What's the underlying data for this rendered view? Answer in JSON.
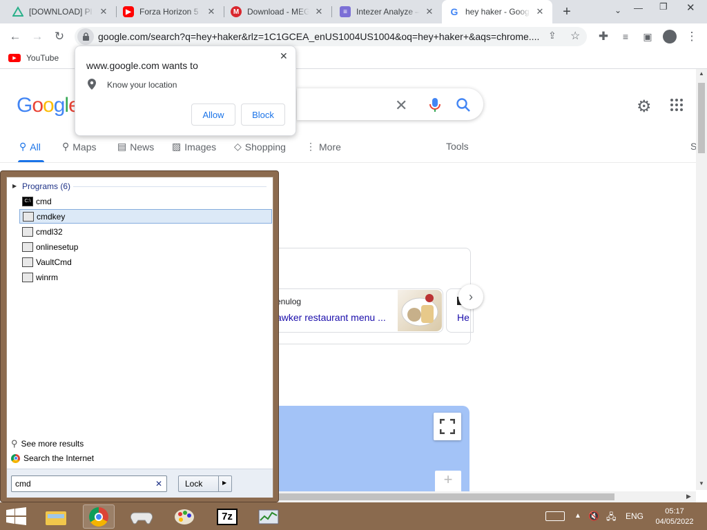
{
  "tabs": [
    {
      "title": "[DOWNLOAD] Pl",
      "icon": "triangle-icon",
      "close": "✕"
    },
    {
      "title": "Forza Horizon 5 (",
      "icon": "youtube-icon",
      "close": "✕"
    },
    {
      "title": "Download - MEG",
      "icon": "mega-icon",
      "close": "✕"
    },
    {
      "title": "Intezer Analyze –",
      "icon": "intezer-icon",
      "close": "✕"
    },
    {
      "title": "hey haker - Goog",
      "icon": "google-icon",
      "close": "✕"
    }
  ],
  "new_tab": "+",
  "url": "google.com/search?q=hey+haker&rlz=1C1GCEA_enUS1004US1004&oq=hey+haker+&aqs=chrome....",
  "bookmarks": [
    {
      "label": "YouTube"
    }
  ],
  "google": {
    "logo": "Google",
    "nav": [
      {
        "label": "All"
      },
      {
        "label": "Maps"
      },
      {
        "label": "News"
      },
      {
        "label": "Images"
      },
      {
        "label": "Shopping"
      },
      {
        "label": "More"
      }
    ],
    "tools": "Tools",
    "safe": "S",
    "card_source": "enulog",
    "card_title": "awker restaurant menu ...",
    "card_title2": "He"
  },
  "popup": {
    "title": "www.google.com wants to",
    "permission": "Know your location",
    "allow": "Allow",
    "block": "Block",
    "close": "✕"
  },
  "startmenu": {
    "group": "Programs (6)",
    "programs": [
      {
        "name": "cmd"
      },
      {
        "name": "cmdkey"
      },
      {
        "name": "cmdl32"
      },
      {
        "name": "onlinesetup"
      },
      {
        "name": "VaultCmd"
      },
      {
        "name": "winrm"
      }
    ],
    "see_more": "See more results",
    "search_internet": "Search the Internet",
    "search_value": "cmd",
    "lock": "Lock",
    "clear": "✕"
  },
  "tray": {
    "lang": "ENG",
    "time": "05:17",
    "date": "04/05/2022"
  }
}
